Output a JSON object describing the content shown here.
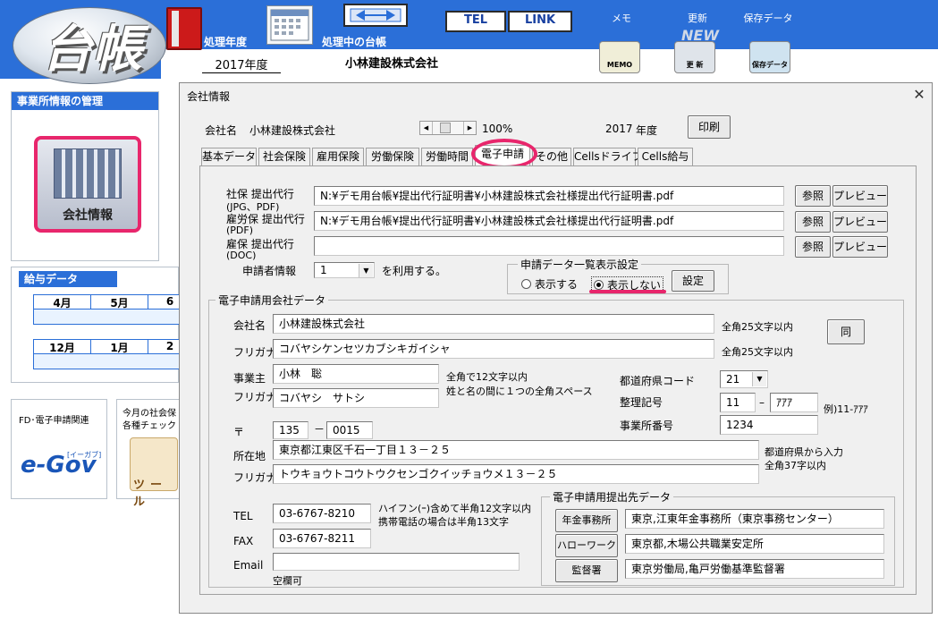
{
  "app": {
    "logo_text": "台帳",
    "year_label": "処理年度",
    "year_value": "2017年度",
    "ledger_label": "処理中の台帳",
    "ledger_value": "小林建設株式会社",
    "tel_button": "TEL",
    "link_button": "LINK",
    "memo_label": "メモ",
    "memo_icon_text": "MEMO",
    "update_label": "更新",
    "update_icon_text": "更 新",
    "update_badge": "NEW",
    "saved_label": "保存データ",
    "saved_icon_text": "保存データ"
  },
  "left": {
    "mgmt_header": "事業所情報の管理",
    "company_button": "会社情報",
    "salary_header": "給与データ",
    "months_row1": [
      "4月",
      "5月",
      "6"
    ],
    "months_row2": [
      "12月",
      "1月",
      "2"
    ],
    "efile_label": "FD･電子申請関連",
    "egov_logo": "e-Gov",
    "egov_tag": "[イーガブ]",
    "monthly_label_1": "今月の社会保",
    "monthly_label_2": "各種チェック",
    "tool_label": "ツール"
  },
  "dialog": {
    "title": "会社情報",
    "company_name_label": "会社名",
    "company_name": "小林建設株式会社",
    "zoom": "100%",
    "year": "2017",
    "year_unit": "年度",
    "print_button": "印刷",
    "tabs": [
      "基本データ",
      "社会保険",
      "雇用保険",
      "労働保険",
      "労働時間",
      "電子申請",
      "その他",
      "Cellsドライブ",
      "Cells給与"
    ],
    "active_tab": "電子申請"
  },
  "filing": {
    "rows": [
      {
        "label1": "社保 提出代行",
        "label2": "(JPG、PDF)",
        "path": "N:¥デモ用台帳¥提出代行証明書¥小林建設株式会社様提出代行証明書.pdf"
      },
      {
        "label1": "雇労保 提出代行",
        "label2": "(PDF)",
        "path": "N:¥デモ用台帳¥提出代行証明書¥小林建設株式会社様提出代行証明書.pdf"
      },
      {
        "label1": "雇保 提出代行",
        "label2": "(DOC)",
        "path": ""
      }
    ],
    "ref_button": "参照",
    "preview_button": "プレビュー",
    "applicant_label": "申請者情報",
    "applicant_value": "1",
    "applicant_suffix": "を利用する。",
    "display_group_label": "申請データ一覧表示設定",
    "radio_show": "表示する",
    "radio_hide": "表示しない",
    "radio_selected": "表示しない",
    "settings_button": "設定"
  },
  "company": {
    "group_label": "電子申請用会社データ",
    "name_label": "会社名",
    "name": "小林建設株式会社",
    "name_note": "全角25文字以内",
    "furigana_label": "フリガナ",
    "name_kana": "コバヤシケンセツカブシキガイシャ",
    "kana_note": "全角25文字以内",
    "same_button": "同",
    "owner_label": "事業主",
    "owner": "小林　聡",
    "owner_kana": "コバヤシ　サトシ",
    "owner_note1": "全角で12文字以内",
    "owner_note2": "姓と名の間に１つの全角スペース",
    "pref_code_label": "都道府県コード",
    "pref_code": "21",
    "ref_no_label": "整理記号",
    "ref_no_1": "11",
    "ref_no_2": "ｱｱｱ",
    "ref_no_example": "例)11-ｱｱｱ",
    "office_no_label": "事業所番号",
    "office_no": "1234",
    "zip_label": "〒",
    "zip1": "135",
    "zip2": "0015",
    "address_label": "所在地",
    "address": "東京都江東区千石一丁目１３－２５",
    "address_kana": "トウキョウトコウトウクセンゴクイッチョウメ１３－２５",
    "address_note1": "都道府県から入力",
    "address_note2": "全角37字以内",
    "tel_label": "TEL",
    "tel": "03-6767-8210",
    "tel_note1": "ハイフン(ｰ)含めて半角12文字以内",
    "tel_note2": "携帯電話の場合は半角13文字",
    "fax_label": "FAX",
    "fax": "03-6767-8211",
    "email_label": "Email",
    "email": "",
    "email_note": "空欄可"
  },
  "submit": {
    "group_label": "電子申請用提出先データ",
    "rows": [
      {
        "button": "年金事務所",
        "value": "東京,江東年金事務所（東京事務センター）"
      },
      {
        "button": "ハローワーク",
        "value": "東京都,木場公共職業安定所"
      },
      {
        "button": "監督署",
        "value": "東京労働局,亀戸労働基準監督署"
      }
    ]
  },
  "colors": {
    "accent_blue": "#2b6fd8",
    "highlight_pink": "#e8266c"
  }
}
